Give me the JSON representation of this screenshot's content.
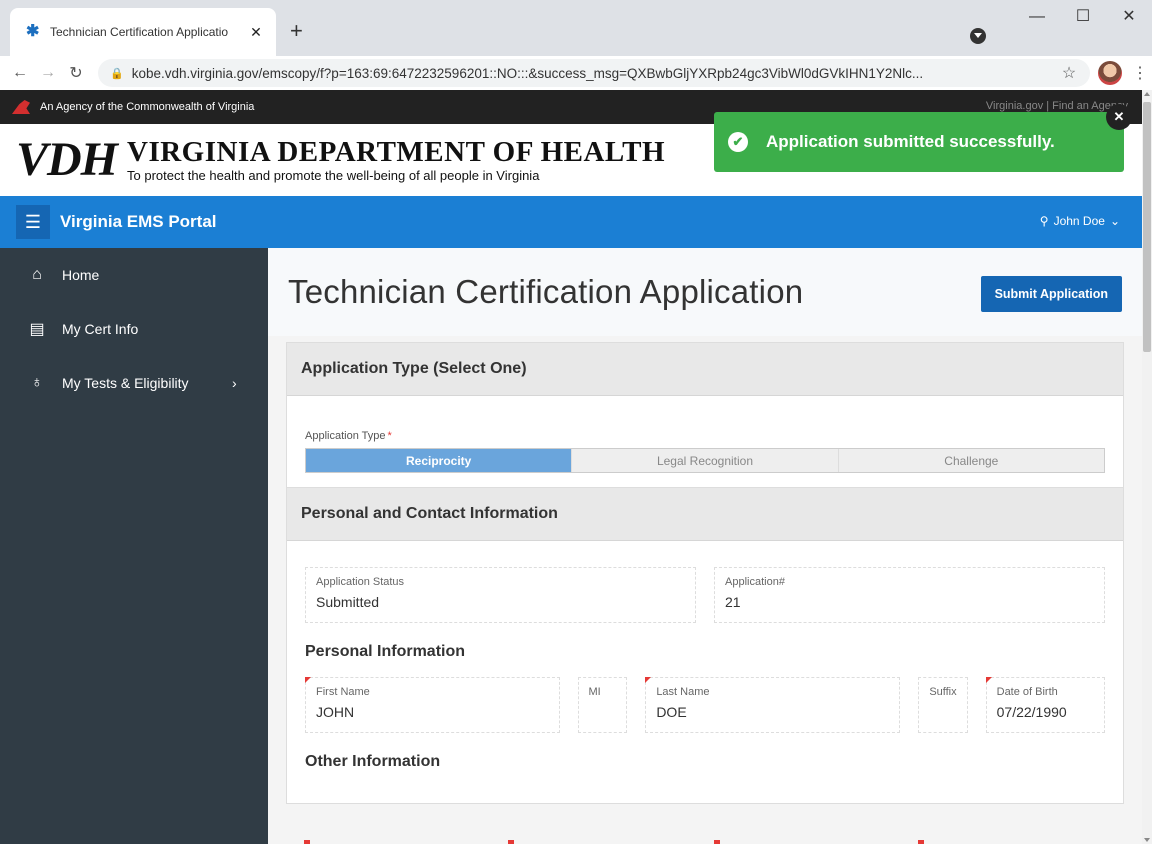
{
  "browser": {
    "tab_title": "Technician Certification Applicatio",
    "tab_close": "✕",
    "new_tab": "+",
    "url": "kobe.vdh.virginia.gov/emscopy/f?p=163:69:6472232596201::NO:::&success_msg=QXBwbGljYXRpb24gc3VibWl0dGVkIHN1Y2Nlc..."
  },
  "agency_bar": {
    "text": "An Agency of the Commonwealth of Virginia",
    "links": "Virginia.gov  |  Find an Agency"
  },
  "header": {
    "logo": "VDH",
    "title": "VIRGINIA DEPARTMENT OF HEALTH",
    "tagline": "To protect the health and promote the well-being of all people in Virginia"
  },
  "app_bar": {
    "title": "Virginia EMS Portal",
    "user": "John Doe"
  },
  "sidebar": {
    "items": [
      {
        "label": "Home",
        "icon": "home-icon"
      },
      {
        "label": "My Cert Info",
        "icon": "id-card-icon"
      },
      {
        "label": "My Tests & Eligibility",
        "icon": "award-icon"
      }
    ]
  },
  "page": {
    "title": "Technician Certification Application",
    "submit_label": "Submit Application"
  },
  "application_type": {
    "region_title": "Application Type (Select One)",
    "label": "Application Type",
    "required_mark": "*",
    "options": [
      "Reciprocity",
      "Legal Recognition",
      "Challenge"
    ],
    "selected": "Reciprocity"
  },
  "personal_contact": {
    "region_title": "Personal and Contact Information",
    "status_label": "Application Status",
    "status_value": "Submitted",
    "number_label": "Application#",
    "number_value": "21",
    "personal_heading": "Personal Information",
    "first_name_label": "First Name",
    "first_name_value": "JOHN",
    "mi_label": "MI",
    "last_name_label": "Last Name",
    "last_name_value": "DOE",
    "suffix_label": "Suffix",
    "dob_label": "Date of Birth",
    "dob_value": "07/22/1990",
    "other_heading": "Other Information"
  },
  "toast": {
    "message": "Application submitted successfully."
  },
  "colors": {
    "app_bar": "#1b7fd4",
    "sidebar": "#303c45",
    "toast": "#3cae4a",
    "primary_button": "#1566b3"
  }
}
